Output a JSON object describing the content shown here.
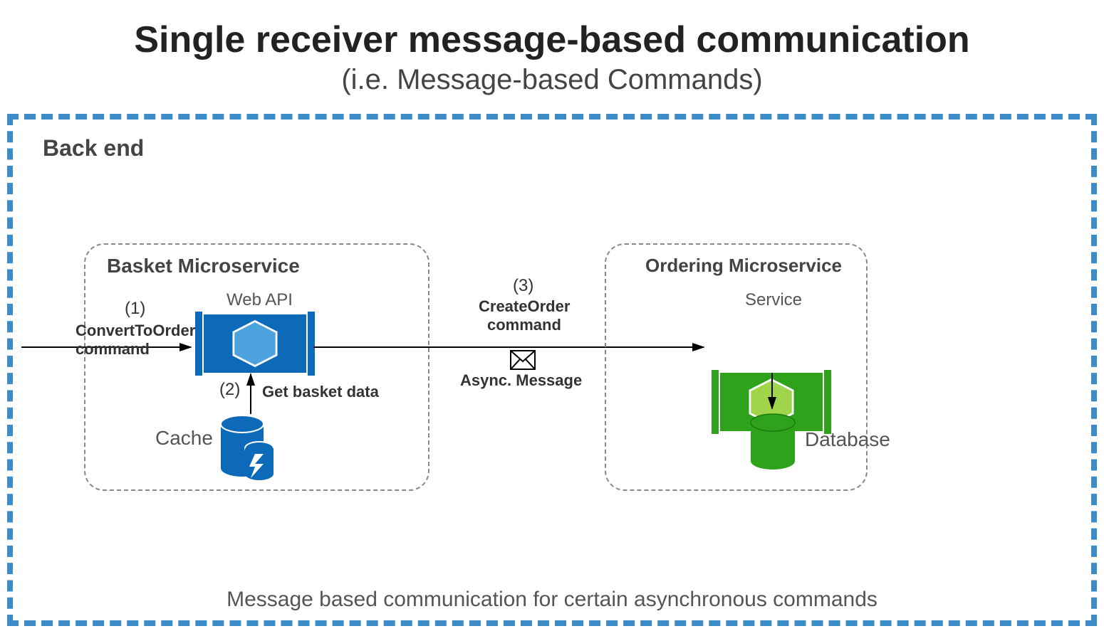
{
  "title": "Single receiver message-based communication",
  "subtitle": "(i.e. Message-based Commands)",
  "backend_label": "Back end",
  "caption": "Message based communication for certain asynchronous commands",
  "basket": {
    "title": "Basket Microservice",
    "api_label": "Web API",
    "cache_label": "Cache",
    "step1_num": "(1)",
    "step1_line1": "ConvertToOrder",
    "step1_line2": "command",
    "step2_num": "(2)",
    "step2_label": "Get basket data"
  },
  "message": {
    "step3_num": "(3)",
    "line1": "CreateOrder",
    "line2": "command",
    "async": "Async. Message"
  },
  "ordering": {
    "title": "Ordering Microservice",
    "service_label": "Service",
    "db_label": "Database"
  },
  "colors": {
    "dash_border": "#3C8CC7",
    "api_blue": "#0D6AB9",
    "api_hex_fill": "#4DA3DE",
    "svc_green": "#2EA21B",
    "svc_hex_fill": "#9FD44B",
    "cache_blue": "#0D6AB9",
    "db_green": "#2EA21B"
  }
}
